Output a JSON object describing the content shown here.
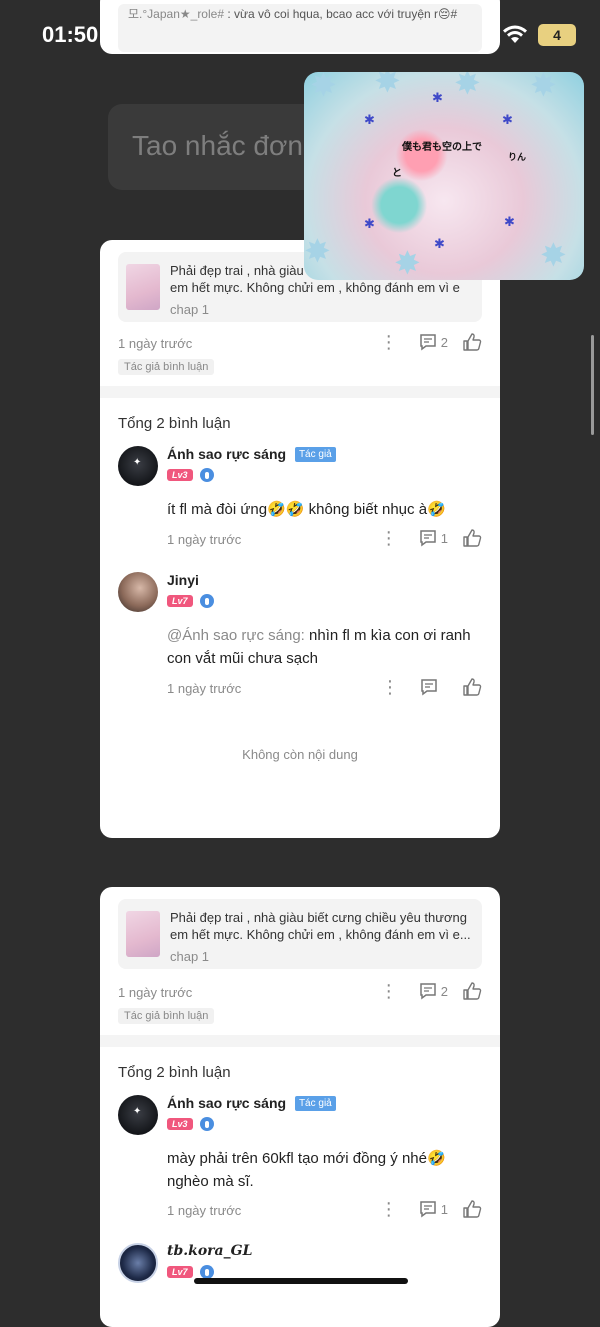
{
  "status_bar": {
    "time": "01:50",
    "battery_level": "4"
  },
  "top_card": {
    "quote_prefix": "모.°Japan",
    "quote_suffix": "_role#",
    "quote_text": ": vừa vô coi hqua, bcao acc với truyện r😔#"
  },
  "background_input": {
    "placeholder": "Tao nhắc đơn"
  },
  "pip_video": {
    "line1": "僕も君も空の上で",
    "line2": "と",
    "line3": "りん"
  },
  "card1": {
    "quote": {
      "text": "Phải đẹp trai , nhà giàu b",
      "text2": "em hết mực. Không chửi em , không đánh em vì e",
      "chapter": "chap 1"
    },
    "time": "1 ngày trước",
    "reply_count": "2",
    "author_tag": "Tác giả bình luận",
    "total_comments": "Tổng 2 bình luận",
    "comments": [
      {
        "username": "Ánh sao rực sáng",
        "badge": "Tác giả",
        "level": "Lv3",
        "text": "ít fl mà đòi ứng🤣🤣 không biết nhục à🤣",
        "time": "1 ngày trước",
        "reply_count": "1"
      },
      {
        "username": "Jinyi",
        "level": "Lv7",
        "mention": "@Ánh sao rực sáng:",
        "text": "nhìn fl m kìa con ơi ranh con vắt mũi chưa sạch",
        "time": "1 ngày trước"
      }
    ],
    "end_text": "Không còn nội dung"
  },
  "card2": {
    "quote": {
      "text": "Phải đẹp trai , nhà giàu biết cưng chiều yêu thương",
      "text2": "em hết mực. Không chửi em , không đánh em vì e...",
      "chapter": "chap 1"
    },
    "time": "1 ngày trước",
    "reply_count": "2",
    "author_tag": "Tác giả bình luận",
    "total_comments": "Tổng 2 bình luận",
    "comments": [
      {
        "username": "Ánh sao rực sáng",
        "badge": "Tác giả",
        "level": "Lv3",
        "text": "mày phải trên 60kfl tạo mới đồng ý nhé🤣 nghèo mà sĩ.",
        "time": "1 ngày trước",
        "reply_count": "1"
      },
      {
        "username": "tb.kora_GL",
        "level": "Lv7"
      }
    ]
  }
}
